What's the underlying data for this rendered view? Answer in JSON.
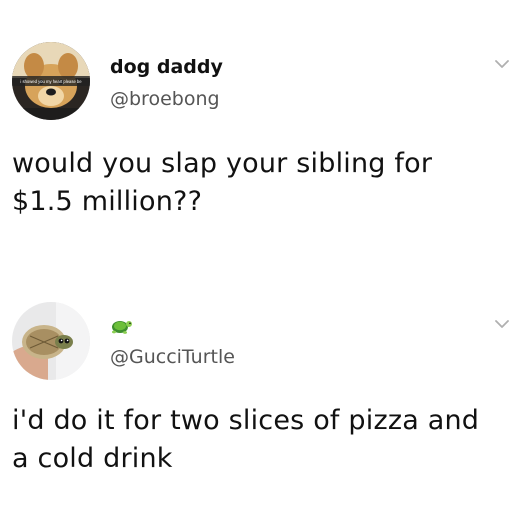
{
  "tweets": [
    {
      "display_name": "dog daddy",
      "handle": "@broebong",
      "avatar_caption": "i showed you my heart please be",
      "text_lines": [
        "would you slap your sibling for",
        "$1.5 million??"
      ]
    },
    {
      "display_name": "",
      "name_emoji": "turtle-emoji",
      "handle": "@GucciTurtle",
      "text_lines": [
        "i'd do it for two slices of pizza and",
        "a cold drink"
      ]
    }
  ],
  "icons": {
    "chevron": "chevron-down-icon"
  },
  "colors": {
    "text": "#111111",
    "handle": "#555555",
    "chevron": "#b0b0b0",
    "background": "#ffffff"
  }
}
